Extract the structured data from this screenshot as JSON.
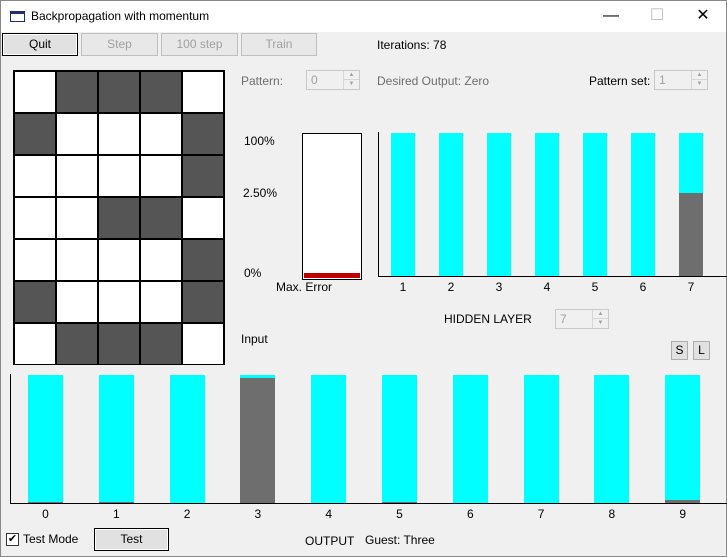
{
  "window": {
    "title": "Backpropagation with momentum",
    "minimize_glyph": "—",
    "maximize_glyph": "☐",
    "close_glyph": "✕"
  },
  "toolbar": {
    "quit": "Quit",
    "step": "Step",
    "step100": "100 step",
    "train": "Train"
  },
  "iterations": "Iterations: 78",
  "pattern": {
    "label": "Pattern:",
    "value": "0"
  },
  "desired_output": "Desired Output: Zero",
  "pattern_set": {
    "label": "Pattern set:",
    "value": "1"
  },
  "input_grid": {
    "label": "Input",
    "rows": [
      [
        0,
        1,
        1,
        1,
        0
      ],
      [
        1,
        0,
        0,
        0,
        1
      ],
      [
        0,
        0,
        0,
        0,
        1
      ],
      [
        0,
        0,
        1,
        1,
        0
      ],
      [
        0,
        0,
        0,
        0,
        1
      ],
      [
        1,
        0,
        0,
        0,
        1
      ],
      [
        0,
        1,
        1,
        1,
        0
      ]
    ]
  },
  "error_meter": {
    "label_100": "100%",
    "label_mid": "2.50%",
    "label_0": "0%",
    "caption": "Max. Error",
    "fraction": 0.035,
    "color": "#c00000"
  },
  "hidden_layer": {
    "label": "HIDDEN LAYER",
    "spin_value": "7",
    "labels": [
      "1",
      "2",
      "3",
      "4",
      "5",
      "6",
      "7"
    ],
    "dark_fraction": [
      0,
      0,
      0,
      0,
      0,
      0,
      0.58
    ]
  },
  "output_layer": {
    "label": "OUTPUT",
    "labels": [
      "0",
      "1",
      "2",
      "3",
      "4",
      "5",
      "6",
      "7",
      "8",
      "9"
    ],
    "dark_fraction": [
      0.01,
      0.01,
      0,
      0.98,
      0,
      0.01,
      0,
      0,
      0,
      0.02
    ]
  },
  "s_button": "S",
  "l_button": "L",
  "test_mode": {
    "label": "Test Mode",
    "checked_glyph": "✔"
  },
  "test_button": "Test",
  "guest": "Guest: Three",
  "colors": {
    "bar": "#00ffff",
    "bar_dark": "#6e6e6e",
    "pixel_on": "#555555",
    "pixel_off": "#ffffff"
  }
}
